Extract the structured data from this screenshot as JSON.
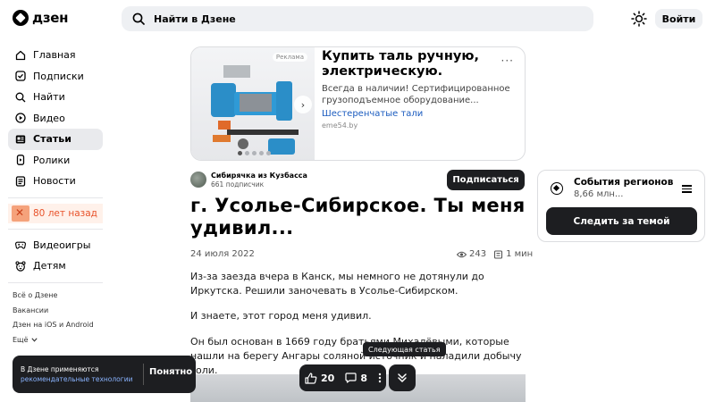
{
  "header": {
    "logo_text": "дзен",
    "search_placeholder": "Найти в Дзене",
    "login_label": "Войти"
  },
  "sidebar": {
    "items": [
      {
        "label": "Главная",
        "icon": "home-icon"
      },
      {
        "label": "Подписки",
        "icon": "subscriptions-icon"
      },
      {
        "label": "Найти",
        "icon": "search-icon"
      },
      {
        "label": "Видео",
        "icon": "video-icon"
      },
      {
        "label": "Статьи",
        "icon": "articles-icon",
        "active": true
      },
      {
        "label": "Ролики",
        "icon": "shorts-icon"
      },
      {
        "label": "Новости",
        "icon": "news-icon"
      }
    ],
    "promo_label": "80 лет назад",
    "items2": [
      {
        "label": "Видеоигры",
        "icon": "gamepad-icon"
      },
      {
        "label": "Детям",
        "icon": "kids-icon"
      }
    ],
    "footer": [
      "Всё о Дзене",
      "Вакансии",
      "Дзен на iOS и Android",
      "Ещё"
    ]
  },
  "ad": {
    "label": "Реклама",
    "title": "Купить таль ручную, электрическую.",
    "description": "Всегда в наличии! Сертифицированное грузоподъемное оборудование...",
    "link": "Шестеренчатые тали",
    "domain": "eme54.by"
  },
  "author": {
    "name": "Сибирячка из Кузбасса",
    "subscribers": "661 подписчик",
    "subscribe_label": "Подписаться"
  },
  "article": {
    "title": "г. Усолье-Сибирское. Ты меня удивил...",
    "date": "24 июля 2022",
    "views": "243",
    "read_time": "1 мин",
    "paragraphs": [
      "Из-за заезда вчера в Канск, мы немного не дотянули до Иркутска. Решили заночевать в Усолье-Сибирском.",
      "И знаете, этот город меня удивил.",
      "Он был основан в 1669 году братьями Михалёвыми, которые нашли на берегу Ангары соляной источник и наладили добычу соли."
    ]
  },
  "widget": {
    "title": "События регионов",
    "subtitle": "8,66 млн...",
    "button_label": "Следить за темой"
  },
  "cookie": {
    "text": "В Дзене применяются",
    "link": "рекомендательные технологии",
    "ok_label": "Понятно"
  },
  "actions": {
    "likes": "20",
    "comments": "8",
    "tooltip": "Следующая статья"
  }
}
